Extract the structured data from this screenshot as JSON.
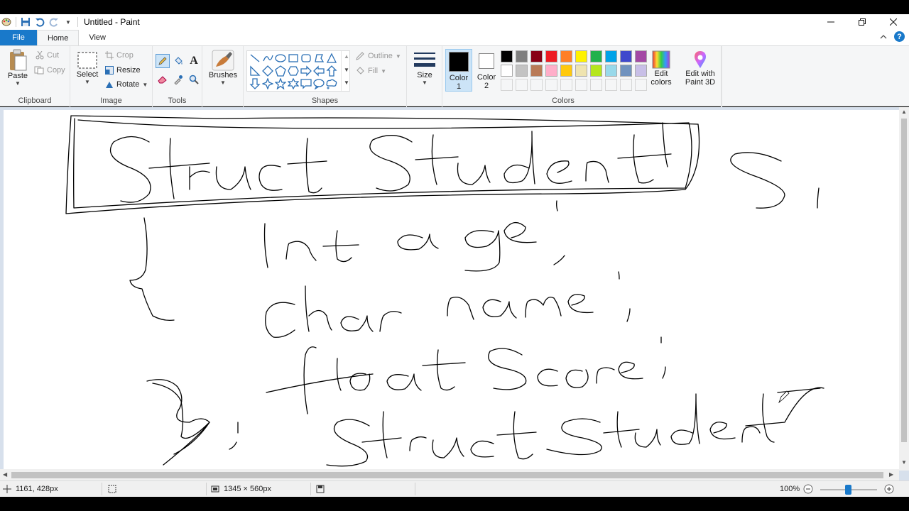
{
  "window": {
    "title": "Untitled - Paint"
  },
  "menu": {
    "file": "File",
    "home": "Home",
    "view": "View"
  },
  "ribbon": {
    "clipboard": {
      "group": "Clipboard",
      "paste": "Paste",
      "cut": "Cut",
      "copy": "Copy"
    },
    "image": {
      "group": "Image",
      "select": "Select",
      "crop": "Crop",
      "resize": "Resize",
      "rotate": "Rotate"
    },
    "tools": {
      "group": "Tools"
    },
    "brushes": {
      "label": "Brushes"
    },
    "shapes": {
      "group": "Shapes",
      "outline": "Outline",
      "fill": "Fill"
    },
    "size": {
      "label": "Size"
    },
    "colors": {
      "group": "Colors",
      "color1_label": "Color",
      "color1_num": "1",
      "color2_label": "Color",
      "color2_num": "2",
      "edit_colors_1": "Edit",
      "edit_colors_2": "colors",
      "paint3d_1": "Edit with",
      "paint3d_2": "Paint 3D",
      "color1": "#000000",
      "color2": "#ffffff",
      "row1": [
        "#000000",
        "#7f7f7f",
        "#880015",
        "#ed1c24",
        "#ff7f27",
        "#fff200",
        "#22b14c",
        "#00a2e8",
        "#3f48cc",
        "#a349a4"
      ],
      "row2": [
        "#ffffff",
        "#c3c3c3",
        "#b97a57",
        "#ffaec9",
        "#ffc90e",
        "#efe4b0",
        "#b5e61d",
        "#99d9ea",
        "#7092be",
        "#c8bfe7"
      ]
    }
  },
  "status": {
    "cursor_pos": "1161, 428px",
    "canvas_size": "1345 × 560px",
    "zoom": "100%",
    "zoom_level_percent": 100
  }
}
